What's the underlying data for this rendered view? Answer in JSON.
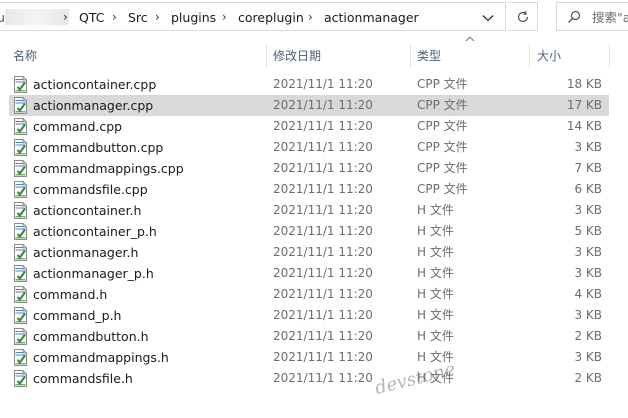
{
  "address_bar": {
    "crumbs": [
      "QTC",
      "Src",
      "plugins",
      "coreplugin",
      "actionmanager"
    ],
    "partial_prefix": "u"
  },
  "search": {
    "placeholder": "搜索\"a"
  },
  "columns": {
    "name": "名称",
    "date": "修改日期",
    "type": "类型",
    "size": "大小"
  },
  "files": [
    {
      "name": "actioncontainer.cpp",
      "date": "2021/11/1 11:20",
      "type": "CPP 文件",
      "size": "18 KB",
      "selected": false
    },
    {
      "name": "actionmanager.cpp",
      "date": "2021/11/1 11:20",
      "type": "CPP 文件",
      "size": "17 KB",
      "selected": true
    },
    {
      "name": "command.cpp",
      "date": "2021/11/1 11:20",
      "type": "CPP 文件",
      "size": "14 KB",
      "selected": false
    },
    {
      "name": "commandbutton.cpp",
      "date": "2021/11/1 11:20",
      "type": "CPP 文件",
      "size": "3 KB",
      "selected": false
    },
    {
      "name": "commandmappings.cpp",
      "date": "2021/11/1 11:20",
      "type": "CPP 文件",
      "size": "7 KB",
      "selected": false
    },
    {
      "name": "commandsfile.cpp",
      "date": "2021/11/1 11:20",
      "type": "CPP 文件",
      "size": "6 KB",
      "selected": false
    },
    {
      "name": "actioncontainer.h",
      "date": "2021/11/1 11:20",
      "type": "H 文件",
      "size": "3 KB",
      "selected": false
    },
    {
      "name": "actioncontainer_p.h",
      "date": "2021/11/1 11:20",
      "type": "H 文件",
      "size": "5 KB",
      "selected": false
    },
    {
      "name": "actionmanager.h",
      "date": "2021/11/1 11:20",
      "type": "H 文件",
      "size": "3 KB",
      "selected": false
    },
    {
      "name": "actionmanager_p.h",
      "date": "2021/11/1 11:20",
      "type": "H 文件",
      "size": "3 KB",
      "selected": false
    },
    {
      "name": "command.h",
      "date": "2021/11/1 11:20",
      "type": "H 文件",
      "size": "4 KB",
      "selected": false
    },
    {
      "name": "command_p.h",
      "date": "2021/11/1 11:20",
      "type": "H 文件",
      "size": "3 KB",
      "selected": false
    },
    {
      "name": "commandbutton.h",
      "date": "2021/11/1 11:20",
      "type": "H 文件",
      "size": "2 KB",
      "selected": false
    },
    {
      "name": "commandmappings.h",
      "date": "2021/11/1 11:20",
      "type": "H 文件",
      "size": "3 KB",
      "selected": false
    },
    {
      "name": "commandsfile.h",
      "date": "2021/11/1 11:20",
      "type": "H 文件",
      "size": "2 KB",
      "selected": false
    }
  ],
  "icons": {
    "file": "source-file-icon",
    "dropdown": "chevron-down-icon",
    "refresh": "refresh-icon",
    "search": "search-icon",
    "sort": "sort-caret-icon"
  },
  "colors": {
    "selected_row": "#d9d9d9",
    "header_text": "#4c607a",
    "icon_green": "#3d8b3d"
  },
  "watermark": "devstone"
}
